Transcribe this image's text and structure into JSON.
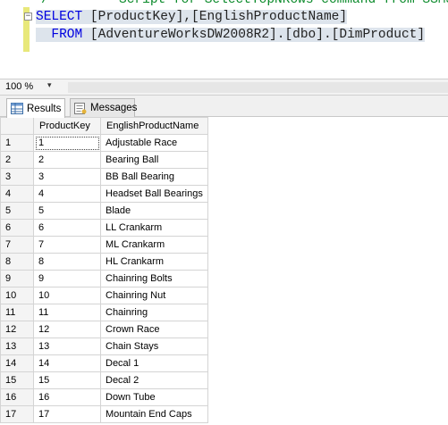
{
  "editor": {
    "comment_fragment": "/  ****** Script for SelectTopNRows command from SSMS",
    "collapse_glyph": "−",
    "line1": {
      "keyword": "SELECT",
      "columns": "[ProductKey],[EnglishProductName]"
    },
    "line2": {
      "keyword": "FROM",
      "table": "[AdventureWorksDW2008R2].[dbo].[DimProduct]"
    }
  },
  "zoom": {
    "value": "100 %",
    "arrow": "▾"
  },
  "tabs": [
    {
      "label": "Results",
      "icon": "results-grid-icon",
      "active": true
    },
    {
      "label": "Messages",
      "icon": "messages-icon",
      "active": false
    }
  ],
  "grid": {
    "columns": [
      "ProductKey",
      "EnglishProductName"
    ],
    "rows": [
      [
        "1",
        "1",
        "Adjustable Race"
      ],
      [
        "2",
        "2",
        "Bearing Ball"
      ],
      [
        "3",
        "3",
        "BB Ball Bearing"
      ],
      [
        "4",
        "4",
        "Headset Ball Bearings"
      ],
      [
        "5",
        "5",
        "Blade"
      ],
      [
        "6",
        "6",
        "LL Crankarm"
      ],
      [
        "7",
        "7",
        "ML Crankarm"
      ],
      [
        "8",
        "8",
        "HL Crankarm"
      ],
      [
        "9",
        "9",
        "Chainring Bolts"
      ],
      [
        "10",
        "10",
        "Chainring Nut"
      ],
      [
        "11",
        "11",
        "Chainring"
      ],
      [
        "12",
        "12",
        "Crown Race"
      ],
      [
        "13",
        "13",
        "Chain Stays"
      ],
      [
        "14",
        "14",
        "Decal 1"
      ],
      [
        "15",
        "15",
        "Decal 2"
      ],
      [
        "16",
        "16",
        "Down Tube"
      ],
      [
        "17",
        "17",
        "Mountain End Caps"
      ]
    ]
  }
}
